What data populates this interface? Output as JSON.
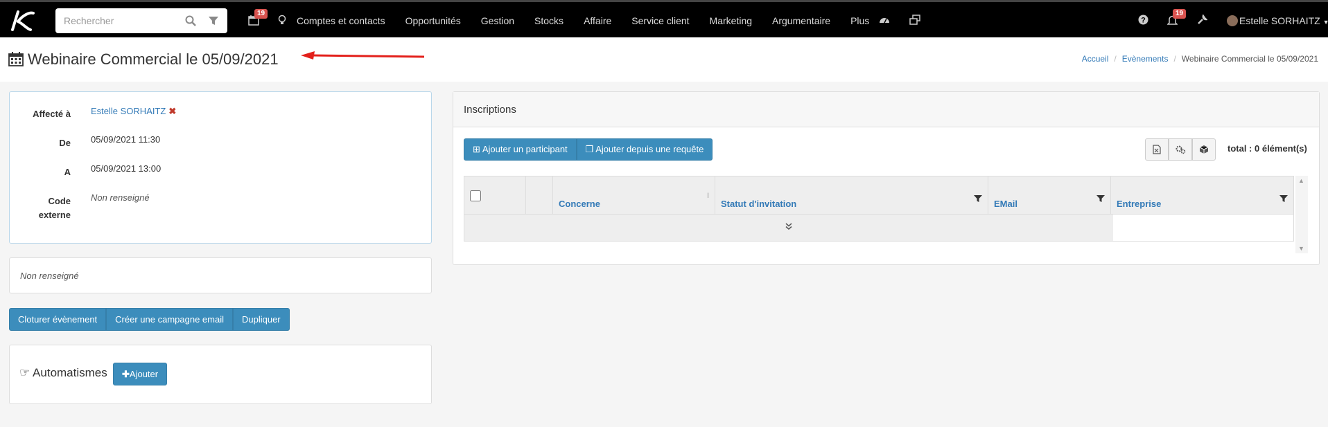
{
  "nav": {
    "search_placeholder": "Rechercher",
    "calendar_badge": "19",
    "menu_items": [
      "Comptes et contacts",
      "Opportunités",
      "Gestion",
      "Stocks",
      "Affaire",
      "Service client",
      "Marketing",
      "Argumentaire",
      "Plus"
    ],
    "notif_badge": "19",
    "user_name": "Estelle SORHAITZ"
  },
  "page": {
    "title": "Webinaire Commercial le 05/09/2021",
    "breadcrumb": [
      "Accueil",
      "Evènements",
      "Webinaire Commercial le 05/09/2021"
    ]
  },
  "info": {
    "assigned_label": "Affecté à",
    "assigned_value": "Estelle SORHAITZ",
    "from_label": "De",
    "from_value": "05/09/2021 11:30",
    "to_label": "A",
    "to_value": "05/09/2021 13:00",
    "code_label_1": "Code",
    "code_label_2": "externe",
    "code_value": "Non renseigné"
  },
  "description": "Non renseigné",
  "actions": [
    "Cloturer évènement",
    "Créer une campagne email",
    "Dupliquer"
  ],
  "automatismes": {
    "title": "Automatismes",
    "add_label": "Ajouter"
  },
  "inscriptions": {
    "title": "Inscriptions",
    "add_participant": "Ajouter un participant",
    "add_from_query": "Ajouter depuis une requête",
    "total": "total : 0 élément(s)",
    "columns": [
      "Concerne",
      "Statut d'invitation",
      "EMail",
      "Entreprise"
    ]
  },
  "colors": {
    "accent": "#3c8dbc",
    "link": "#337ab7",
    "badge": "#d9534f",
    "navbar": "#000000"
  }
}
